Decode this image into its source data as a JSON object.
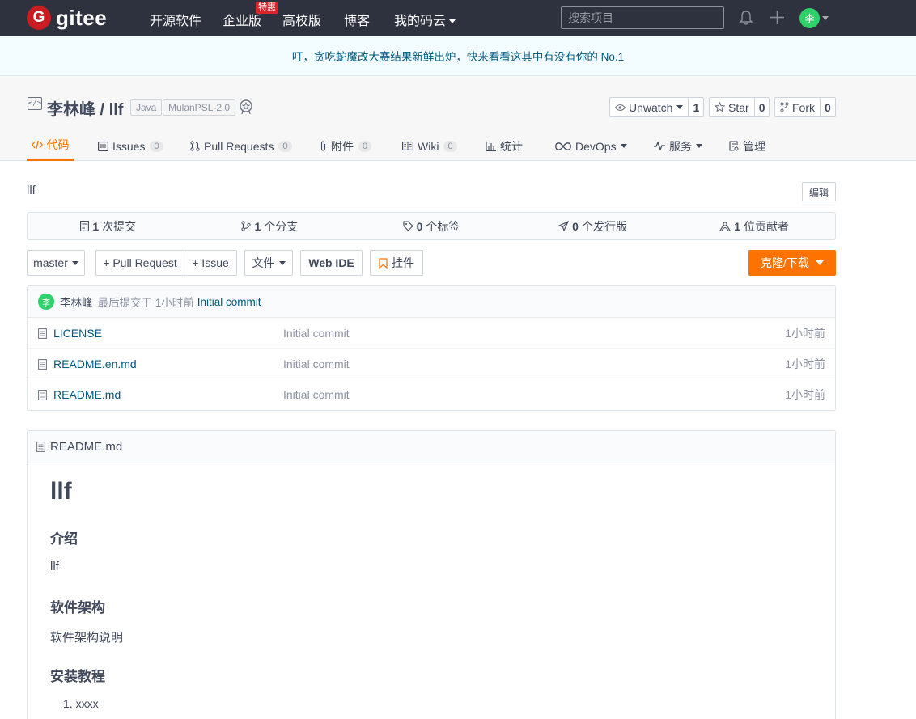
{
  "nav": {
    "logo_letter": "G",
    "logo_text": "gitee",
    "items": [
      "开源软件",
      "企业版",
      "高校版",
      "博客",
      "我的码云"
    ],
    "hot_badge": "特惠",
    "search_placeholder": "搜索项目",
    "avatar_text": "李"
  },
  "announcement": "叮，贪吃蛇魔改大赛结果新鲜出炉，快来看看这其中有没有你的 No.1",
  "repo": {
    "title": "李林峰 / llf",
    "tags": [
      "Java",
      "MulanPSL-2.0"
    ],
    "watch": {
      "label": "Unwatch",
      "count": "1"
    },
    "star": {
      "label": "Star",
      "count": "0"
    },
    "fork": {
      "label": "Fork",
      "count": "0"
    }
  },
  "tabs": [
    {
      "label": "代码",
      "count": null
    },
    {
      "label": "Issues",
      "count": "0"
    },
    {
      "label": "Pull Requests",
      "count": "0"
    },
    {
      "label": "附件",
      "count": "0"
    },
    {
      "label": "Wiki",
      "count": "0"
    },
    {
      "label": "统计",
      "count": null
    },
    {
      "label": "DevOps",
      "count": null
    },
    {
      "label": "服务",
      "count": null
    },
    {
      "label": "管理",
      "count": null
    }
  ],
  "description": "llf",
  "edit_label": "编辑",
  "stats": [
    {
      "num": "1",
      "label": "次提交"
    },
    {
      "num": "1",
      "label": "个分支"
    },
    {
      "num": "0",
      "label": "个标签"
    },
    {
      "num": "0",
      "label": "个发行版"
    },
    {
      "num": "1",
      "label": "位贡献者"
    }
  ],
  "toolbar": {
    "branch": "master",
    "pull_request": "+ Pull Request",
    "issue": "+ Issue",
    "files": "文件",
    "web_ide": "Web IDE",
    "widget": "挂件",
    "clone": "克隆/下载"
  },
  "commit": {
    "avatar_text": "李",
    "author": "李林峰",
    "meta": "最后提交于 1小时前",
    "message": "Initial commit"
  },
  "files": [
    {
      "name": "LICENSE",
      "message": "Initial commit",
      "time": "1小时前"
    },
    {
      "name": "README.en.md",
      "message": "Initial commit",
      "time": "1小时前"
    },
    {
      "name": "README.md",
      "message": "Initial commit",
      "time": "1小时前"
    }
  ],
  "readme": {
    "filename": "README.md",
    "h1": "llf",
    "intro_heading": "介绍",
    "intro_text": "llf",
    "arch_heading": "软件架构",
    "arch_text": "软件架构说明",
    "install_heading": "安装教程",
    "install_item": "1. xxxx"
  },
  "colors": {
    "accent": "#fe7300",
    "nav_bg": "#2e323e",
    "link": "#005980"
  }
}
